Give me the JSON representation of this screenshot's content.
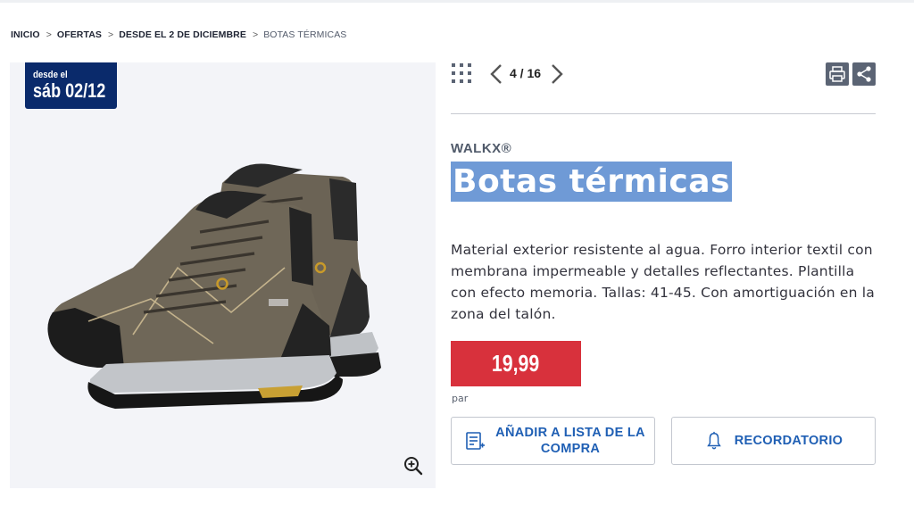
{
  "breadcrumb": {
    "items": [
      "INICIO",
      "OFERTAS",
      "DESDE EL 2 DE DICIEMBRE",
      "BOTAS TÉRMICAS"
    ],
    "separator": ">"
  },
  "badge": {
    "top": "desde el",
    "date": "sáb 02/12"
  },
  "gallery": {
    "counter": "4 / 16"
  },
  "product": {
    "brand": "WALKX®",
    "title": "Botas térmicas",
    "description": "Material exterior resistente al agua. Forro interior textil con membrana impermeable y detalles reflectantes. Plantilla con efecto memoria. Tallas: 41-45. Con amortiguación en la zona del talón.",
    "price": "19,99",
    "unit": "par"
  },
  "actions": {
    "shopping_list": "AÑADIR A LISTA DE LA COMPRA",
    "reminder": "RECORDATORIO"
  },
  "icons": [
    "grid-icon",
    "chevron-left-icon",
    "chevron-right-icon",
    "print-icon",
    "share-icon",
    "zoom-in-icon",
    "shopping-list-icon",
    "bell-icon"
  ],
  "colors": {
    "badge_bg": "#0a2a6b",
    "price_bg": "#d8313c",
    "action_text": "#1f5fb4",
    "title_highlight": "#6f9ad6"
  }
}
